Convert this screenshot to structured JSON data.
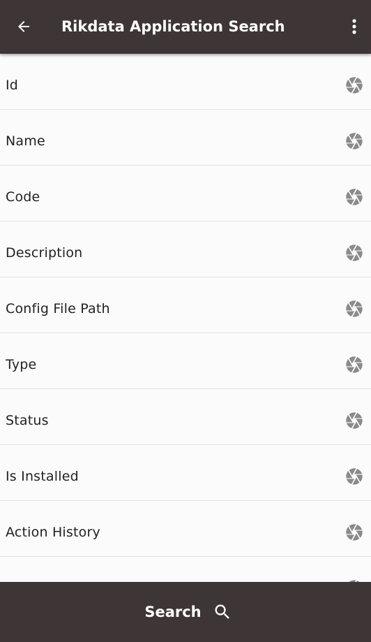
{
  "header": {
    "title": "Rikdata Application Search",
    "back_icon": "arrow-left-icon",
    "menu_icon": "more-vertical-icon"
  },
  "fields": [
    {
      "label": "Id",
      "icon": "aperture-icon"
    },
    {
      "label": "Name",
      "icon": "aperture-icon"
    },
    {
      "label": "Code",
      "icon": "aperture-icon"
    },
    {
      "label": "Description",
      "icon": "aperture-icon"
    },
    {
      "label": "Config File Path",
      "icon": "aperture-icon"
    },
    {
      "label": "Type",
      "icon": "aperture-icon"
    },
    {
      "label": "Status",
      "icon": "aperture-icon"
    },
    {
      "label": "Is Installed",
      "icon": "aperture-icon"
    },
    {
      "label": "Action History",
      "icon": "aperture-icon"
    },
    {
      "label": "",
      "icon": "aperture-icon"
    }
  ],
  "footer": {
    "search_label": "Search",
    "search_icon": "search-icon"
  },
  "colors": {
    "bar": "#3d3536",
    "background": "#fafafa",
    "icon": "#8a8a8a",
    "text": "#222222"
  }
}
